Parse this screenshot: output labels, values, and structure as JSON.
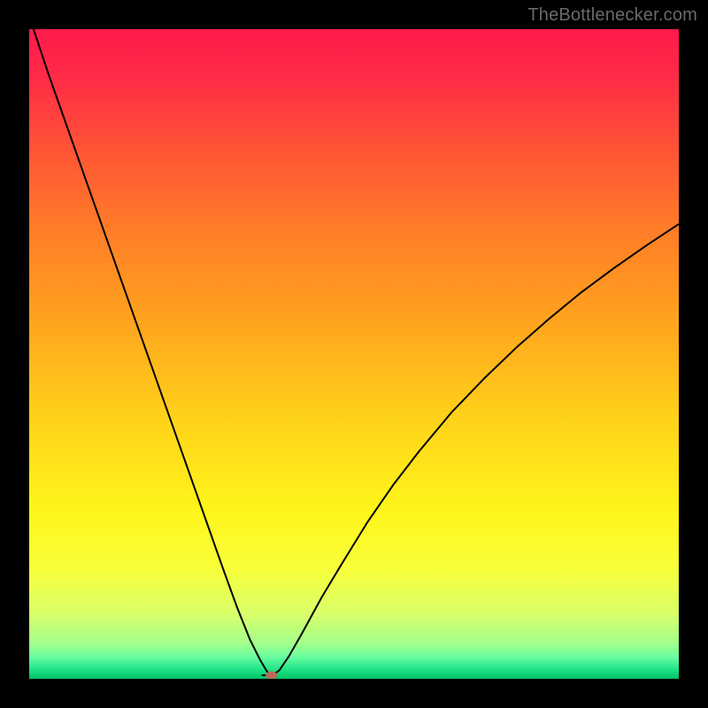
{
  "attribution": "TheBottlenecker.com",
  "colors": {
    "frame": "#000000",
    "curve": "#000000",
    "marker_fill": "#b96a57",
    "marker_stroke": "#b96a57"
  },
  "chart_data": {
    "type": "line",
    "title": "",
    "xlabel": "",
    "ylabel": "",
    "xlim": [
      0,
      100
    ],
    "ylim": [
      0,
      100
    ],
    "gradient_stops": [
      {
        "offset": 0.0,
        "color": "#ff1a4a"
      },
      {
        "offset": 0.07,
        "color": "#ff2a47"
      },
      {
        "offset": 0.18,
        "color": "#ff5236"
      },
      {
        "offset": 0.3,
        "color": "#ff7a28"
      },
      {
        "offset": 0.45,
        "color": "#ffa41e"
      },
      {
        "offset": 0.6,
        "color": "#ffd21a"
      },
      {
        "offset": 0.74,
        "color": "#fff51a"
      },
      {
        "offset": 0.83,
        "color": "#f8ff3a"
      },
      {
        "offset": 0.9,
        "color": "#d9ff6a"
      },
      {
        "offset": 0.945,
        "color": "#a4ff8a"
      },
      {
        "offset": 0.965,
        "color": "#6dffa0"
      },
      {
        "offset": 0.985,
        "color": "#22e48a"
      },
      {
        "offset": 1.0,
        "color": "#00c063"
      }
    ],
    "series": [
      {
        "name": "bottleneck-curve",
        "x": [
          0.0,
          3.0,
          6.0,
          9.0,
          12.0,
          15.0,
          18.0,
          21.0,
          24.0,
          27.0,
          30.0,
          32.0,
          34.0,
          35.5,
          36.5,
          37.0,
          37.5,
          38.5,
          40.0,
          42.0,
          45.0,
          48.0,
          52.0,
          56.0,
          60.0,
          65.0,
          70.0,
          75.0,
          80.0,
          85.0,
          90.0,
          95.0,
          100.0
        ],
        "y": [
          102.0,
          93.0,
          84.5,
          76.0,
          67.5,
          59.0,
          50.5,
          42.0,
          33.5,
          25.0,
          16.5,
          11.0,
          6.0,
          3.0,
          1.3,
          0.6,
          0.6,
          1.3,
          3.5,
          7.0,
          12.5,
          17.5,
          24.0,
          29.8,
          35.0,
          41.0,
          46.2,
          51.0,
          55.4,
          59.5,
          63.2,
          66.7,
          70.0
        ]
      }
    ],
    "marker": {
      "x": 37.3,
      "y": 0.55,
      "rx": 6.5,
      "ry": 4.2
    },
    "plateau": {
      "x0": 35.9,
      "x1": 37.1,
      "y": 0.55
    }
  }
}
